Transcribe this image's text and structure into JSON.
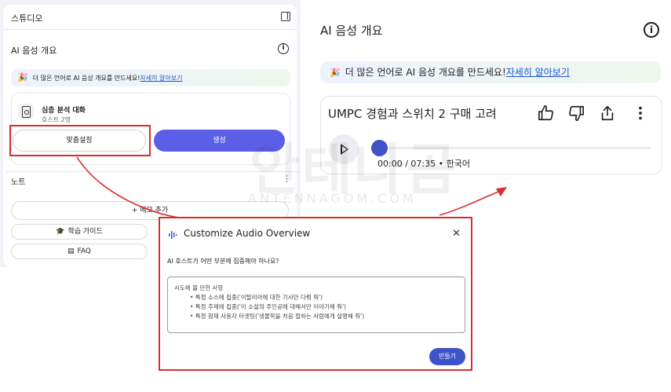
{
  "studio": {
    "title": "스튜디오",
    "audio_overview_title": "AI 음성 개요",
    "banner_text": "더 많은 언어로 AI 음성 개요를 만드세요!",
    "banner_link": "자세히 알아보기",
    "item": {
      "title": "심층 분석 대화",
      "subtitle": "호스트 2명"
    },
    "customize_label": "맞춤설정",
    "generate_label": "생성",
    "notes_title": "노트",
    "add_memo_label": "메모 추가",
    "study_guide_label": "학습 가이드",
    "faq_label": "FAQ"
  },
  "main": {
    "title": "AI 음성 개요",
    "banner_text": "더 많은 언어로 AI 음성 개요를 만드세요!",
    "banner_link": "자세히 알아보기",
    "player": {
      "title": "UMPC 경험과 스위치 2 구매 고려",
      "time": "00:00 / 07:35 • 한국어",
      "progress": 0
    }
  },
  "dialog": {
    "title": "Customize Audio Overview",
    "question": "AI 호스트가 어떤 부분에 집중해야 하나요?",
    "placeholder_heading": "시도해 볼 만한 사항",
    "placeholder_items": [
      "• 특정 소스에 집중('이탈리아에 대한 기사만 다뤄 줘')",
      "• 특정 주제에 집중('이 소설의 주인공에 대해서만 이야기해 줘')",
      "• 특정 잠재 사용자 타겟팅('생물학을 처음 접하는 사람에게 설명해 줘')"
    ],
    "create_label": "만들기"
  },
  "watermark": {
    "korean": "안테나곰",
    "latin": "ANTENNAGOM.COM"
  },
  "colors": {
    "accent_red": "#d92d2d",
    "primary_blue": "#3e53c7",
    "generate_purple": "#5b5ee6"
  }
}
